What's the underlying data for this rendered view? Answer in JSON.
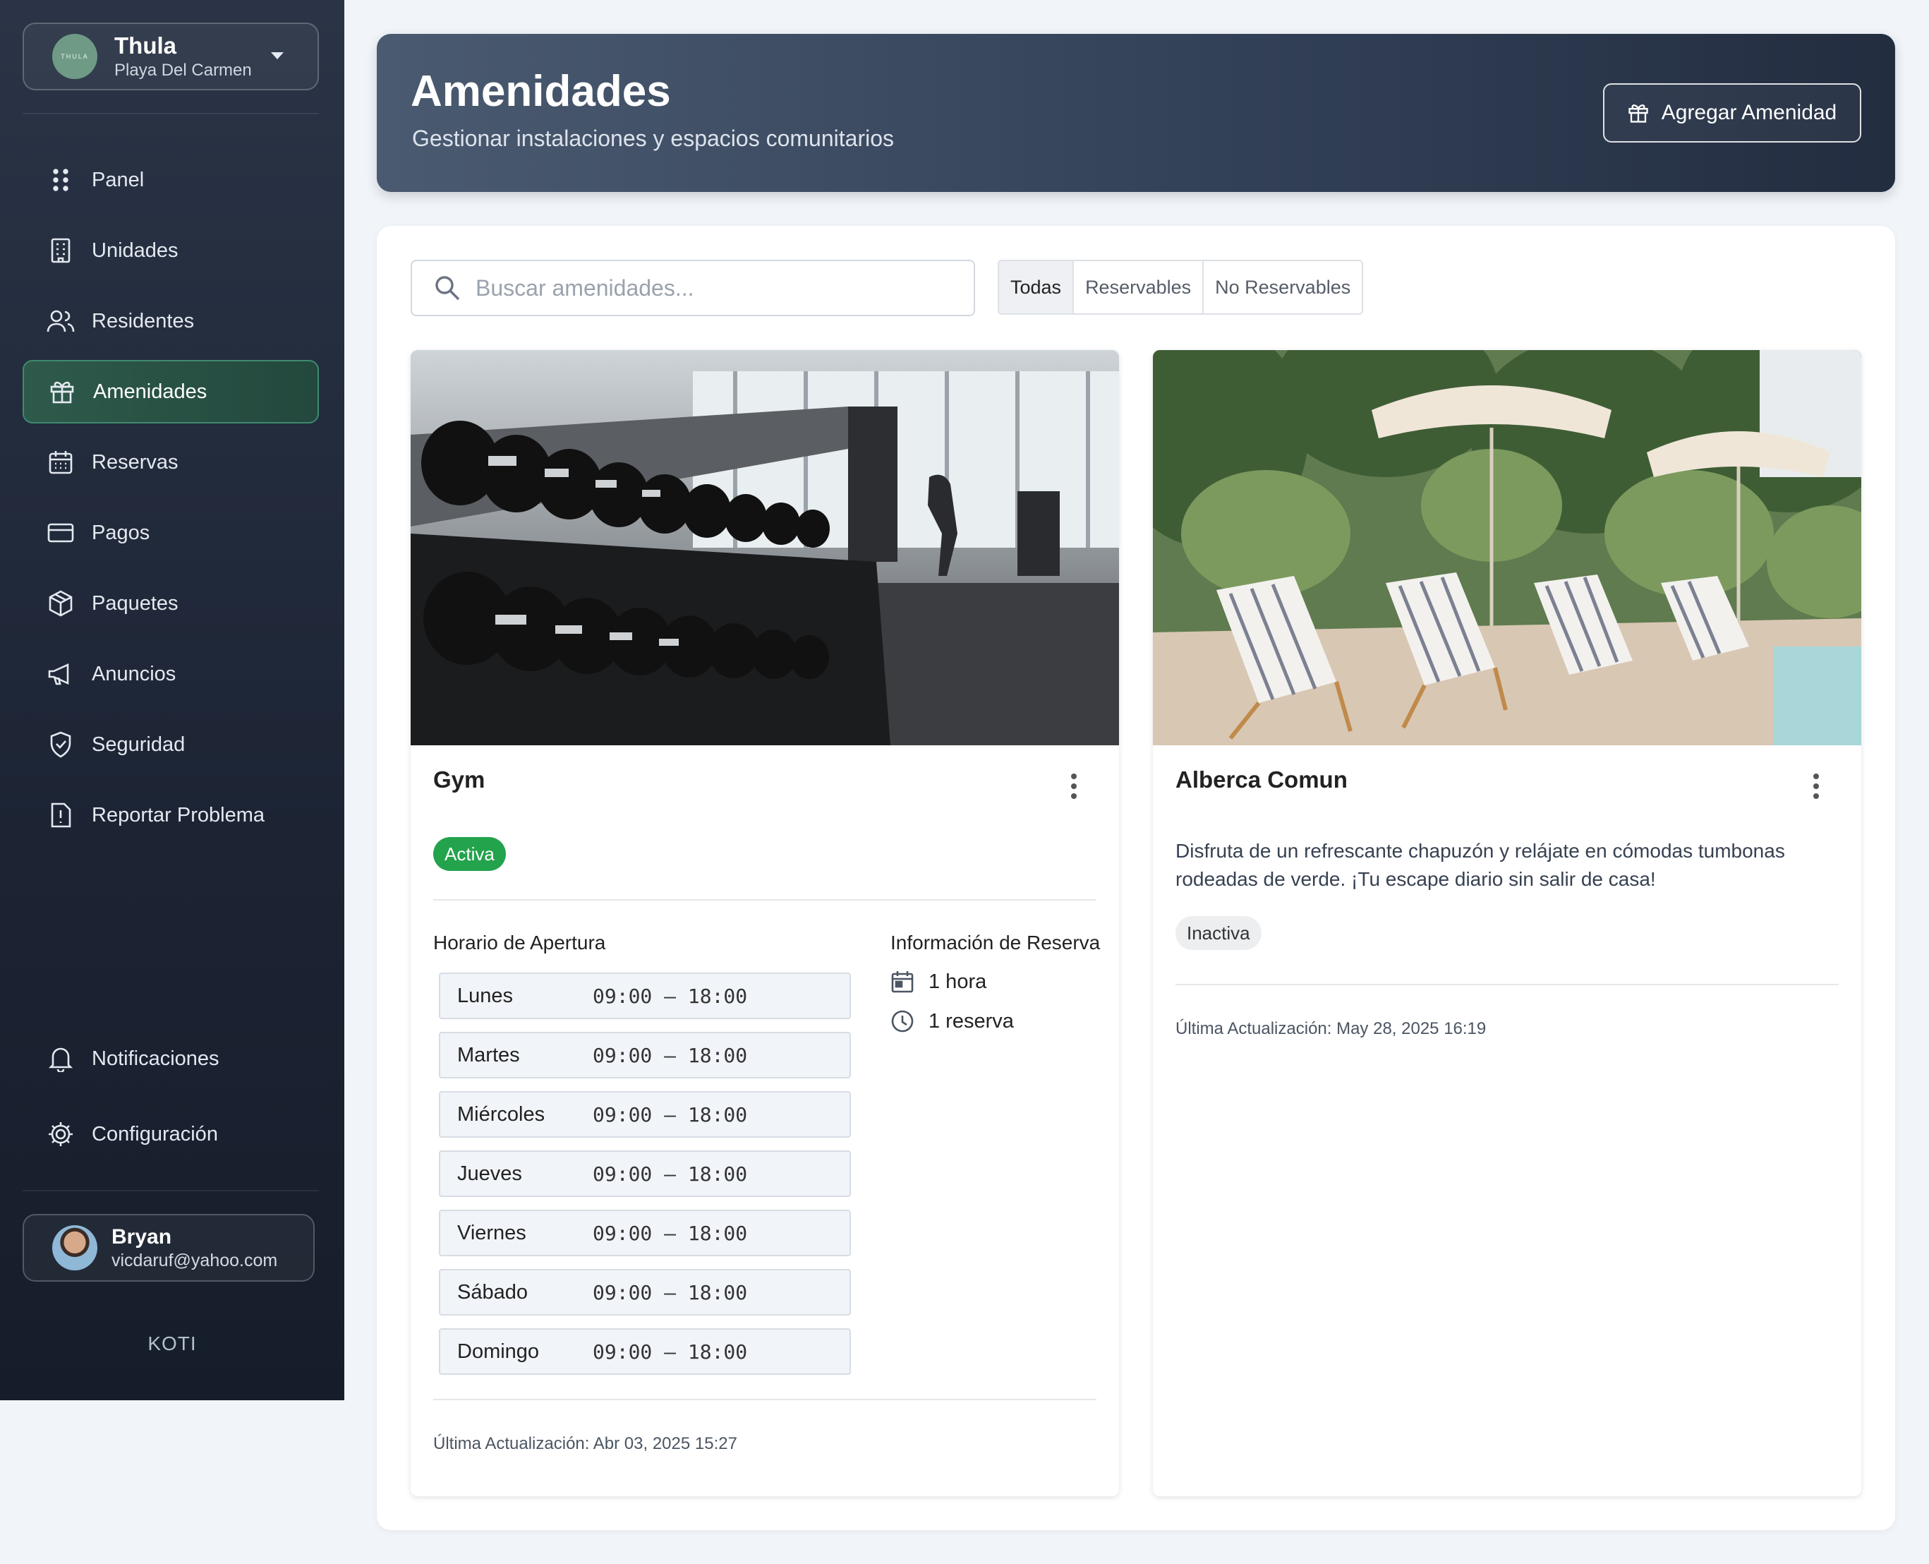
{
  "org": {
    "name": "Thula",
    "location": "Playa Del Carmen",
    "logo_text": "THULA"
  },
  "nav": {
    "items": [
      {
        "label": "Panel",
        "icon": "grid-dots-icon"
      },
      {
        "label": "Unidades",
        "icon": "building-icon"
      },
      {
        "label": "Residentes",
        "icon": "users-icon"
      },
      {
        "label": "Amenidades",
        "icon": "gift-icon",
        "active": true
      },
      {
        "label": "Reservas",
        "icon": "calendar-icon"
      },
      {
        "label": "Pagos",
        "icon": "credit-card-icon"
      },
      {
        "label": "Paquetes",
        "icon": "package-icon"
      },
      {
        "label": "Anuncios",
        "icon": "megaphone-icon"
      },
      {
        "label": "Seguridad",
        "icon": "shield-check-icon"
      },
      {
        "label": "Reportar Problema",
        "icon": "report-icon"
      }
    ],
    "bottom": [
      {
        "label": "Notificaciones",
        "icon": "bell-icon"
      },
      {
        "label": "Configuración",
        "icon": "gear-icon"
      }
    ]
  },
  "user": {
    "name": "Bryan",
    "email": "vicdaruf@yahoo.com"
  },
  "brand": "KOTI",
  "header": {
    "title": "Amenidades",
    "subtitle": "Gestionar instalaciones y espacios comunitarios",
    "add_button": "Agregar Amenidad"
  },
  "search": {
    "placeholder": "Buscar amenidades..."
  },
  "filters": [
    "Todas",
    "Reservables",
    "No Reservables"
  ],
  "amenities": [
    {
      "name": "Gym",
      "status": "Activa",
      "hours_label": "Horario de Apertura",
      "hours": [
        {
          "day": "Lunes",
          "time": "09:00 – 18:00"
        },
        {
          "day": "Martes",
          "time": "09:00 – 18:00"
        },
        {
          "day": "Miércoles",
          "time": "09:00 – 18:00"
        },
        {
          "day": "Jueves",
          "time": "09:00 – 18:00"
        },
        {
          "day": "Viernes",
          "time": "09:00 – 18:00"
        },
        {
          "day": "Sábado",
          "time": "09:00 – 18:00"
        },
        {
          "day": "Domingo",
          "time": "09:00 – 18:00"
        }
      ],
      "booking_label": "Información de Reserva",
      "booking_duration": "1 hora",
      "booking_limit": "1 reserva",
      "updated": "Última Actualización: Abr 03, 2025 15:27"
    },
    {
      "name": "Alberca Comun",
      "description": "Disfruta de un refrescante chapuzón y relájate en cómodas tumbonas rodeadas de verde. ¡Tu escape diario sin salir de casa!",
      "status": "Inactiva",
      "updated": "Última Actualización: May 28, 2025 16:19"
    }
  ],
  "colors": {
    "active_green": "#22a34c",
    "sidebar_bg": "#1c2434",
    "nav_active": "#2e5a4b"
  }
}
